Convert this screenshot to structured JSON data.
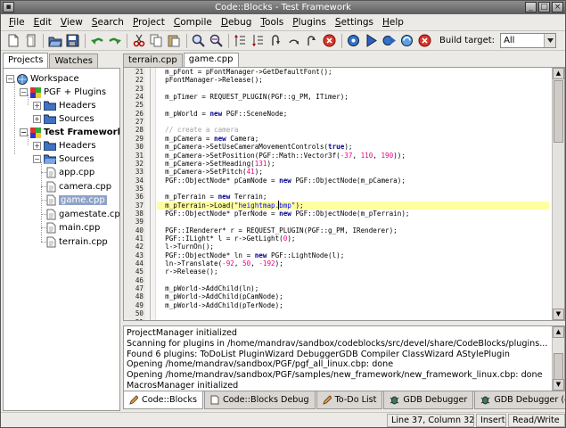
{
  "window": {
    "title": "Code::Blocks - Test Framework"
  },
  "menu": [
    "File",
    "Edit",
    "View",
    "Search",
    "Project",
    "Compile",
    "Debug",
    "Tools",
    "Plugins",
    "Settings",
    "Help"
  ],
  "toolbar": {
    "build_target_label": "Build target:",
    "build_target_value": "All"
  },
  "left_tabs": [
    "Projects",
    "Watches"
  ],
  "tree": {
    "workspace": "Workspace",
    "project1": "PGF + Plugins",
    "p1_headers": "Headers",
    "p1_sources": "Sources",
    "project2": "Test Framework",
    "p2_headers": "Headers",
    "p2_sources": "Sources",
    "files": [
      "app.cpp",
      "camera.cpp",
      "game.cpp",
      "gamestate.cpp",
      "main.cpp",
      "terrain.cpp"
    ]
  },
  "editor_tabs": [
    "terrain.cpp",
    "game.cpp"
  ],
  "editor": {
    "line_numbers": [
      "21",
      "22",
      "23",
      "24",
      "25",
      "26",
      "27",
      "28",
      "29",
      "30",
      "31",
      "32",
      "33",
      "34",
      "35",
      "36",
      "37",
      "38",
      "39",
      "40",
      "41",
      "42",
      "43",
      "44",
      "45",
      "46",
      "47",
      "48",
      "49",
      "50",
      "51"
    ],
    "current_line": "37"
  },
  "log_lines": [
    "ProjectManager initialized",
    "Scanning for plugins in /home/mandrav/sandbox/codeblocks/src/devel/share/CodeBlocks/plugins...",
    "Found 6 plugins: ToDoList PluginWizard DebuggerGDB Compiler ClassWizard AStylePlugin",
    "Opening /home/mandrav/sandbox/PGF/pgf_all_linux.cbp: done",
    "Opening /home/mandrav/sandbox/PGF/samples/new_framework/new_framework_linux.cbp: done",
    "MacrosManager initialized"
  ],
  "log_tabs": [
    "Code::Blocks",
    "Code::Blocks Debug",
    "To-Do List",
    "GDB Debugger",
    "GDB Debugger (debug)"
  ],
  "status": {
    "position": "Line 37, Column 32",
    "mode": "Insert",
    "access": "Read/Write"
  }
}
